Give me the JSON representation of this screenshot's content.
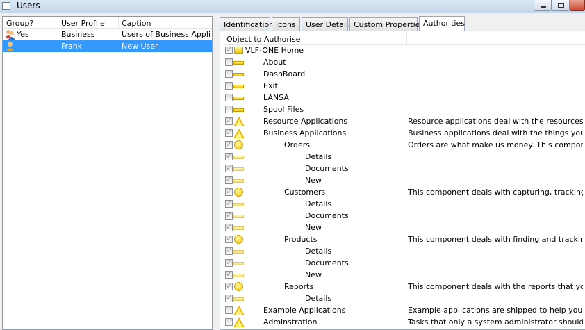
{
  "window": {
    "title": "Users"
  },
  "users_list": {
    "columns": [
      "Group?",
      "User Profile",
      "Caption"
    ],
    "rows": [
      {
        "group": "Yes",
        "profile": "Business",
        "caption": "Users of Business Appli...",
        "icon": "group-users-icon",
        "selected": false
      },
      {
        "group": "",
        "profile": "Frank",
        "caption": "New User",
        "icon": "user-icon",
        "selected": true
      }
    ]
  },
  "tabs": [
    "Identification",
    "Icons",
    "User Details",
    "Custom Properties",
    "Authorities"
  ],
  "active_tab": "Authorities",
  "authorities": {
    "column_header": "Object to Authorise",
    "items": [
      {
        "label": "VLF-ONE Home",
        "desc": "",
        "icon": "home-icon",
        "checked": true
      },
      {
        "label": "About",
        "desc": "",
        "icon": "bar-icon",
        "checked": false
      },
      {
        "label": "DashBoard",
        "desc": "",
        "icon": "bar-icon",
        "checked": false
      },
      {
        "label": "Exit",
        "desc": "",
        "icon": "bar-icon",
        "checked": false
      },
      {
        "label": "LANSA",
        "desc": "",
        "icon": "bar-icon",
        "checked": false
      },
      {
        "label": "Spool Files",
        "desc": "",
        "icon": "bar-icon",
        "checked": false
      },
      {
        "label": "Resource Applications",
        "desc": "Resource applications deal with the resources in ...",
        "icon": "triangle-icon",
        "checked": true
      },
      {
        "label": "Business Applications",
        "desc": "Business applications deal with the things you use...",
        "icon": "triangle-icon",
        "checked": true
      },
      {
        "label": "Orders",
        "desc": "Orders are what make us money. This component...",
        "icon": "circle-icon",
        "checked": true
      },
      {
        "label": "Details",
        "desc": "",
        "icon": "bar-icon",
        "checked": true
      },
      {
        "label": "Documents",
        "desc": "",
        "icon": "bar-icon",
        "checked": true
      },
      {
        "label": "New",
        "desc": "",
        "icon": "bar-icon",
        "checked": true
      },
      {
        "label": "Customers",
        "desc": "This component deals with capturing, tracking an...",
        "icon": "circle-icon",
        "checked": true
      },
      {
        "label": "Details",
        "desc": "",
        "icon": "bar-icon",
        "checked": true
      },
      {
        "label": "Documents",
        "desc": "",
        "icon": "bar-icon",
        "checked": true
      },
      {
        "label": "New",
        "desc": "",
        "icon": "bar-icon",
        "checked": true
      },
      {
        "label": "Products",
        "desc": "This component deals with finding and tracking th...",
        "icon": "circle-icon",
        "checked": true
      },
      {
        "label": "Details",
        "desc": "",
        "icon": "bar-icon",
        "checked": true
      },
      {
        "label": "Documents",
        "desc": "",
        "icon": "bar-icon",
        "checked": true
      },
      {
        "label": "New",
        "desc": "",
        "icon": "bar-icon",
        "checked": true
      },
      {
        "label": "Reports",
        "desc": "This component deals with the reports that you n...",
        "icon": "circle-icon",
        "checked": true
      },
      {
        "label": "Details",
        "desc": "",
        "icon": "bar-icon",
        "checked": true
      },
      {
        "label": "Example Applications",
        "desc": "Example applications are shipped to help you to u...",
        "icon": "triangle-icon",
        "checked": false
      },
      {
        "label": "Adminstration",
        "desc": "Tasks that only a system administrator should be ...",
        "icon": "triangle-icon",
        "checked": false
      }
    ]
  },
  "colors": {
    "selection": "#3399ff",
    "icon_yellow": "#f2c600"
  }
}
